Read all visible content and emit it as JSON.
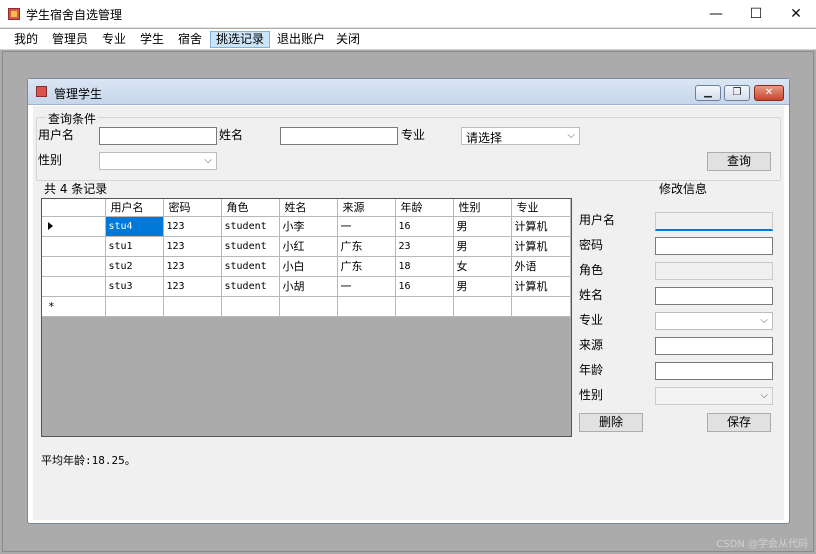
{
  "app": {
    "title": "学生宿舍自选管理"
  },
  "window_controls": {
    "minimize": "—",
    "maximize": "☐",
    "close": "✕"
  },
  "menu": [
    "我的",
    "管理员",
    "专业",
    "学生",
    "宿舍",
    "挑选记录",
    "退出账户",
    "关闭"
  ],
  "child": {
    "title": "管理学生",
    "controls": {
      "minimize": "▁",
      "restore": "❐",
      "close": "✕"
    }
  },
  "query": {
    "legend": "查询条件",
    "username_label": "用户名",
    "name_label": "姓名",
    "major_label": "专业",
    "major_value": "请选择",
    "gender_label": "性别",
    "gender_value": "",
    "search_button": "查询"
  },
  "record_count": "共 4 条记录",
  "table": {
    "columns": [
      "用户名",
      "密码",
      "角色",
      "姓名",
      "来源",
      "年龄",
      "性别",
      "专业"
    ],
    "rows": [
      [
        "stu4",
        "123",
        "student",
        "小李",
        "一",
        "16",
        "男",
        "计算机"
      ],
      [
        "stu1",
        "123",
        "student",
        "小红",
        "广东",
        "23",
        "男",
        "计算机"
      ],
      [
        "stu2",
        "123",
        "student",
        "小白",
        "广东",
        "18",
        "女",
        "外语"
      ],
      [
        "stu3",
        "123",
        "student",
        "小胡",
        "一",
        "16",
        "男",
        "计算机"
      ]
    ]
  },
  "edit": {
    "title": "修改信息",
    "username_label": "用户名",
    "password_label": "密码",
    "role_label": "角色",
    "name_label": "姓名",
    "major_label": "专业",
    "origin_label": "来源",
    "age_label": "年龄",
    "gender_label": "性别",
    "delete_button": "删除",
    "save_button": "保存"
  },
  "average_age": "平均年龄:18.25。",
  "watermark": "CSDN @学会从代码"
}
